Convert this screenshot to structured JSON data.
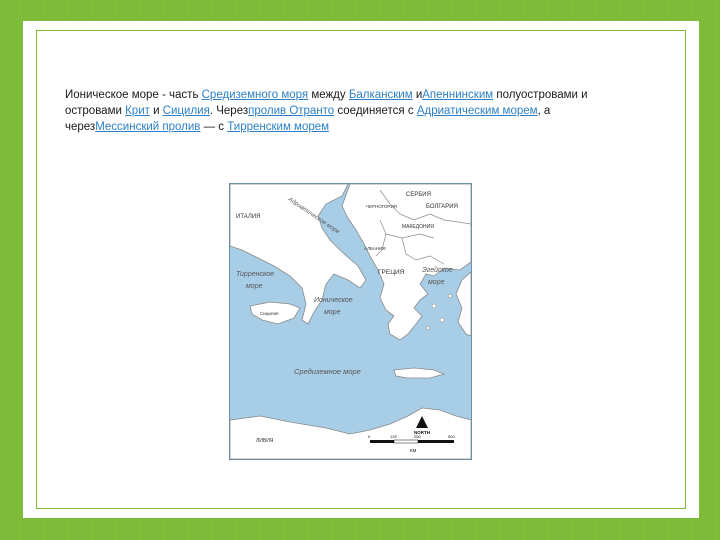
{
  "slide": {
    "paragraph": [
      {
        "t": "Ионическое море -  часть ",
        "link": false
      },
      {
        "t": "Средиземного моря",
        "link": true
      },
      {
        "t": " между ",
        "link": false
      },
      {
        "t": "Балканским",
        "link": true
      },
      {
        "t": " и",
        "link": false
      },
      {
        "t": "Апеннинским",
        "link": true
      },
      {
        "t": " полуостровами и островами ",
        "link": false
      },
      {
        "t": "Крит",
        "link": true
      },
      {
        "t": " и ",
        "link": false
      },
      {
        "t": "Сицилия",
        "link": true
      },
      {
        "t": ". Через",
        "link": false
      },
      {
        "t": "пролив Отранто",
        "link": true
      },
      {
        "t": " соединяется с ",
        "link": false
      },
      {
        "t": "Адриатическим морем",
        "link": true
      },
      {
        "t": ", а через",
        "link": false
      },
      {
        "t": "Мессинский пролив",
        "link": true
      },
      {
        "t": " — с ",
        "link": false
      },
      {
        "t": "Тирренским морем",
        "link": true
      }
    ]
  },
  "map": {
    "labels": {
      "italy": "ИТАЛИЯ",
      "serbia": "СЕРБИЯ",
      "montenegro": "ЧЕРНОГОРИЯ",
      "bulgaria": "БОЛГАРИЯ",
      "macedonia": "МАКЕДОНИЯ",
      "albania": "АЛБАНИЯ",
      "greece": "ГРЕЦИЯ",
      "libya": "ЛИВИЯ",
      "sicily": "Сицилия",
      "adriatic": "Адриатическое море",
      "tyrrhenian_1": "Тирренское",
      "tyrrhenian_2": "море",
      "ionian_1": "Ионическое",
      "ionian_2": "море",
      "aegean_1": "Эгейское",
      "aegean_2": "море",
      "mediterranean": "Средиземное море",
      "north": "NORTH",
      "km": "КМ",
      "scale": [
        "0",
        "125",
        "250",
        "500"
      ]
    },
    "colors": {
      "sea": "#a8cde6",
      "land": "#ffffff",
      "border": "#8a8a8a"
    }
  }
}
